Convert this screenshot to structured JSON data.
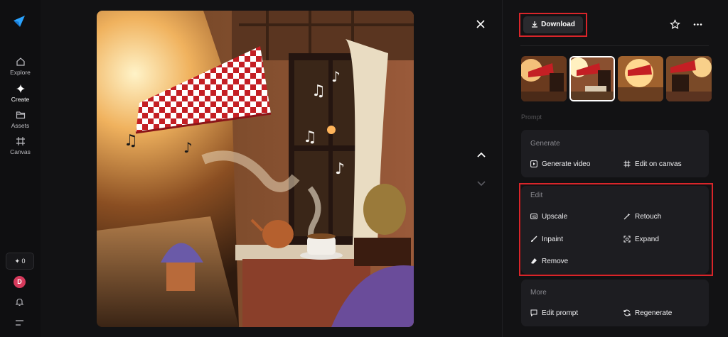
{
  "nav": {
    "items": [
      {
        "label": "Explore",
        "icon": "home-icon"
      },
      {
        "label": "Create",
        "icon": "sparkle-icon"
      },
      {
        "label": "Assets",
        "icon": "folder-icon"
      },
      {
        "label": "Canvas",
        "icon": "frame-icon"
      }
    ],
    "credits": "✦ 0",
    "avatar_initial": "D"
  },
  "toolbar": {
    "download_label": "Download"
  },
  "prompt_label": "Prompt",
  "generate": {
    "title": "Generate",
    "generate_video": "Generate video",
    "edit_on_canvas": "Edit on canvas"
  },
  "edit": {
    "title": "Edit",
    "upscale": "Upscale",
    "retouch": "Retouch",
    "inpaint": "Inpaint",
    "expand": "Expand",
    "remove": "Remove"
  },
  "more": {
    "title": "More",
    "edit_prompt": "Edit prompt",
    "regenerate": "Regenerate"
  },
  "colors": {
    "accent_highlight": "#d9252a",
    "background": "#121214",
    "card": "#1d1d21"
  }
}
